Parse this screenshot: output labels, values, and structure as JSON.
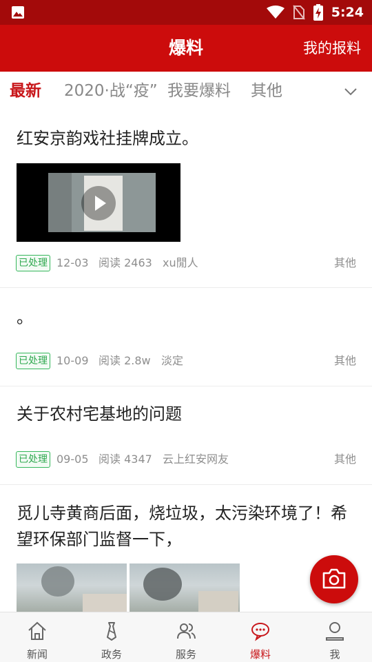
{
  "status_bar": {
    "time": "5:24",
    "icons": [
      "image-icon",
      "wifi-icon",
      "no-sim-icon",
      "battery-charging-icon"
    ]
  },
  "header": {
    "title": "爆料",
    "my_report_label": "我的报料"
  },
  "tabs": [
    {
      "label": "最新",
      "active": true
    },
    {
      "label": "2020·战“疫”",
      "active": false
    },
    {
      "label": "我要爆料",
      "active": false
    },
    {
      "label": "其他",
      "active": false
    }
  ],
  "expand_icon": "chevron-down-icon",
  "feed": [
    {
      "title": "红安京韵戏社挂牌成立。",
      "status": "已处理",
      "date": "12-03",
      "reads": "阅读 2463",
      "author": "xu閒人",
      "category": "其他",
      "media": "video"
    },
    {
      "title": "。",
      "status": "已处理",
      "date": "10-09",
      "reads": "阅读 2.8w",
      "author": "淡定",
      "category": "其他",
      "media": "none"
    },
    {
      "title": "关于农村宅基地的问题",
      "status": "已处理",
      "date": "09-05",
      "reads": "阅读 4347",
      "author": "云上红安网友",
      "category": "其他",
      "media": "none"
    },
    {
      "title": "觅儿寺黄商后面，烧垃圾，太污染环境了！希望环保部门监督一下，",
      "media": "photos"
    }
  ],
  "fab_icon": "camera-icon",
  "bottom_nav": [
    {
      "label": "新闻",
      "icon": "home-icon",
      "active": false
    },
    {
      "label": "政务",
      "icon": "tie-icon",
      "active": false
    },
    {
      "label": "服务",
      "icon": "people-icon",
      "active": false
    },
    {
      "label": "爆料",
      "icon": "chat-bubble-icon",
      "active": true
    },
    {
      "label": "我",
      "icon": "user-icon",
      "active": false
    }
  ],
  "colors": {
    "brand_red": "#cc0c0c",
    "status_bar": "#a30a0a",
    "active_tab": "#c8171b",
    "badge_green": "#2fa84f",
    "meta_gray": "#8e8e8e"
  }
}
